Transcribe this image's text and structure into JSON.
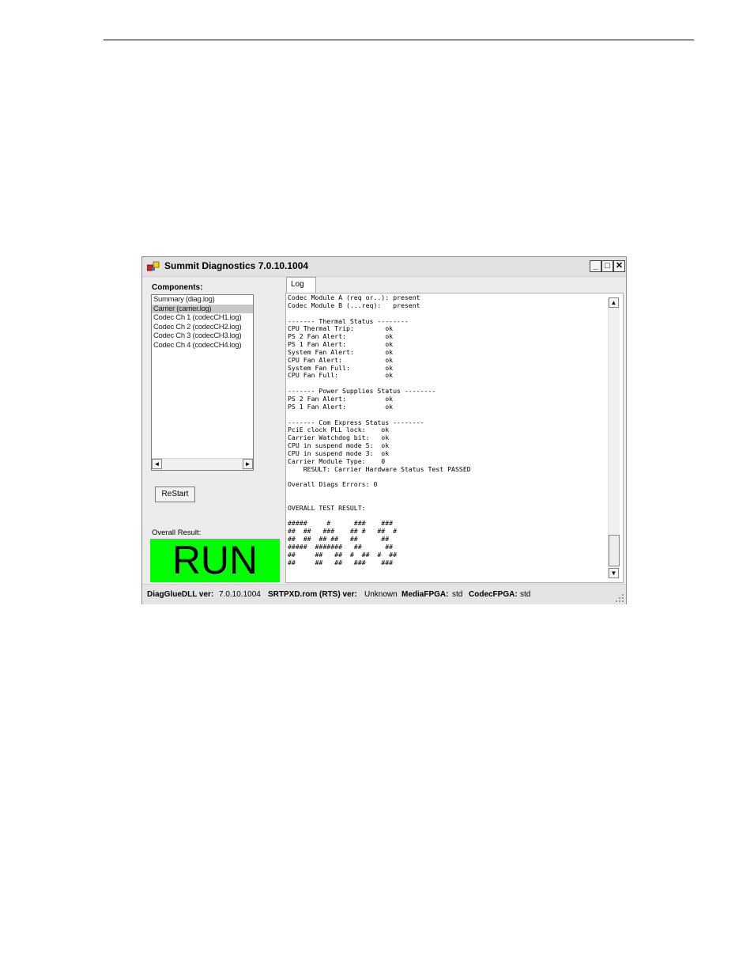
{
  "window": {
    "title": "Summit Diagnostics 7.0.10.1004",
    "minimize_glyph": "_",
    "maximize_glyph": "□",
    "close_glyph": "✕"
  },
  "components": {
    "label": "Components:",
    "items": [
      "Summary (diag.log)",
      "Carrier (carrier.log)",
      "Codec Ch 1 (codecCH1.log)",
      "Codec Ch 2 (codecCH2.log)",
      "Codec Ch 3 (codecCH3.log)",
      "Codec Ch 4 (codecCH4.log)"
    ],
    "selected_index": 1
  },
  "restart_label": "ReStart",
  "overall": {
    "label": "Overall Result:",
    "value": "RUN",
    "color": "#00ff00"
  },
  "tabs": [
    "Log"
  ],
  "log": {
    "text": "Codec Module A (req or..): present\nCodec Module B (...req):   present\n\n------- Thermal Status --------\nCPU Thermal Trip:        ok\nPS 2 Fan Alert:          ok\nPS 1 Fan Alert:          ok\nSystem Fan Alert:        ok\nCPU Fan Alert:           ok\nSystem Fan Full:         ok\nCPU Fan Full:            ok\n\n------- Power Supplies Status --------\nPS 2 Fan Alert:          ok\nPS 1 Fan Alert:          ok\n\n------- Com Express Status --------\nPciE clock PLL lock:    ok\nCarrier Watchdog bit:   ok\nCPU in suspend mode 5:  ok\nCPU in suspend mode 3:  ok\nCarrier Module Type:    0\n    RESULT: Carrier Hardware Status Test PASSED\n\nOverall Diags Errors: 0\n\n\nOVERALL TEST RESULT:\n\n#####     #      ###    ###\n##  ##   ###    ## #   ##  #\n##  ##  ## ##   ##      ##\n#####  #######   ##      ##\n##     ##   ##  #  ##  #  ##\n##     ##   ##   ###    ###"
  },
  "status": {
    "diagglue_key": "DiagGlueDLL ver:",
    "diagglue_val": "7.0.10.1004",
    "srtpxd_key": "SRTPXD.rom (RTS) ver:",
    "srtpxd_val": "Unknown",
    "media_key": "MediaFPGA:",
    "media_val": "std",
    "codec_key": "CodecFPGA:",
    "codec_val": "std"
  },
  "icons": {
    "scroll_left": "◄",
    "scroll_right": "►",
    "scroll_up": "▲",
    "scroll_down": "▼"
  }
}
